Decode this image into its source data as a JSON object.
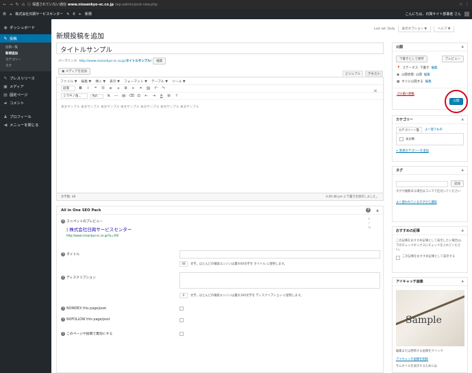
{
  "browser": {
    "security": "保護されていない通信",
    "host": "www.nissankyo-sc.co.jp",
    "path": "/wp-admin/post-new.php"
  },
  "adminbar": {
    "site_name": "株式会社日興サービスセンター",
    "comments_count": "0",
    "new_label": "新規",
    "greeting": "こんにちは、日興サイト部署者 さん"
  },
  "sidebar": {
    "items": [
      {
        "label": "ダッシュボード",
        "icon": "dashboard-icon"
      },
      {
        "label": "投稿",
        "icon": "pin-icon"
      },
      {
        "label": "プレスリリース",
        "icon": "pin-icon"
      },
      {
        "label": "メディア",
        "icon": "media-icon"
      },
      {
        "label": "固定ページ",
        "icon": "pages-icon"
      },
      {
        "label": "コメント",
        "icon": "comment-icon"
      },
      {
        "label": "プロフィール",
        "icon": "user-icon"
      },
      {
        "label": "メニューを閉じる",
        "icon": "collapse-icon"
      }
    ],
    "submenu": [
      "投稿一覧",
      "新規追加",
      "カテゴリー",
      "タグ"
    ]
  },
  "header": {
    "title": "新規投稿を追加",
    "screen_tabs": [
      "表示オプション ▼",
      "ヘルプ ▼"
    ],
    "last_login": "Last set: Daily"
  },
  "post": {
    "title": "タイトルサンプル",
    "permalink_label": "パーマリンク:",
    "permalink_base": "http://www.nissankyo-sc.co.jp/",
    "permalink_slug": "タイトルサンプル/",
    "permalink_edit": "編集",
    "add_media": "メディアを追加",
    "mode_visual": "ビジュアル",
    "mode_text": "テキスト",
    "menubar": [
      "ファイル ▼",
      "編集 ▼",
      "挿入 ▼",
      "表示 ▼",
      "フォーマット ▼",
      "テーブル ▼",
      "ツール ▼"
    ],
    "format_select": "段落",
    "font_select": "ミラギノ角...",
    "size_select": "9pt",
    "body_text": "本文サンプル 本文サンプル 本文サンプル 本文サンプル 本文サンプル 本文サンプル 本文サンプル",
    "word_count": "文字数: 48",
    "saved_status": "3:40:48 pm に下書きを保存しました。"
  },
  "seo": {
    "title": "All in One SEO Pack",
    "snippet_label": "スニペットのプレビュー",
    "snippet_title": "| 株式会社日興サービスセンター",
    "snippet_url": "http://www.nissankyo-sc.co.jp/?p=192",
    "title_label": "タイトル",
    "title_count": "48",
    "title_hint": "文字。ほとんどの検索エンジンは最大60文字を タイトル に使用します。",
    "desc_label": "ディスクリプション",
    "desc_count": "0",
    "desc_hint": "文字。ほとんどの検索エンジンは最大160文字を ディスクリプション に使用します。",
    "noindex_label": "NOINDEX this page/post",
    "nofollow_label": "NOFOLLOW this page/post",
    "disable_label": "このページや投稿で無効にする"
  },
  "publish": {
    "title": "公開",
    "save_draft": "下書きとして保存",
    "preview": "プレビュー",
    "status": "ステータス: 下書き",
    "visibility": "公開状態: 公開",
    "schedule": "すぐに公開する",
    "edit_link": "編集",
    "trash": "ゴミ箱へ移動",
    "publish_button": "公開"
  },
  "categories": {
    "title": "カテゴリー",
    "tab_all": "カテゴリー一覧",
    "tab_popular": "よく使うもの",
    "item": "未分類",
    "add_new": "+ 新規カテゴリーを追加"
  },
  "tags": {
    "title": "タグ",
    "add_button": "追加",
    "hint": "タグが複数ある場合はコンマで区切ってください",
    "popular": "よく使われているタグから選択"
  },
  "recommend": {
    "title": "おすすめの記事",
    "desc": "この記事をおすすめ記事として表示したい場合は、下のチェックボックスにチェックを入れてください。",
    "checkbox_label": "この記事をおすすめ記事として表示する"
  },
  "eyecatch": {
    "title": "アイキャッチ画像",
    "sample_text": "Sample",
    "edit_hint": "編集または更新する画像をクリック",
    "remove": "アイキャッチ画像を削除",
    "thumb_note": "サムネイルを表示するためには"
  }
}
